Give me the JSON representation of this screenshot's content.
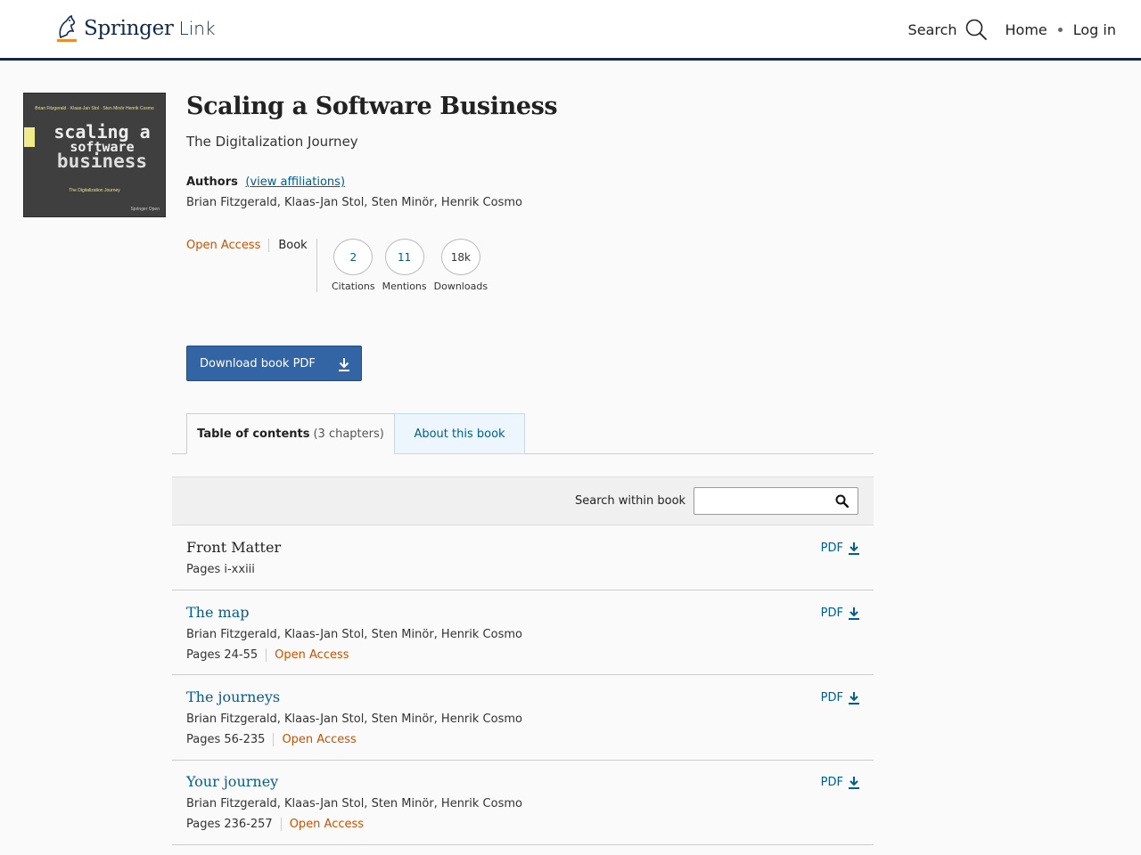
{
  "header": {
    "logo_word": "Springer",
    "logo_sub": "Link",
    "nav": {
      "search": "Search",
      "home": "Home",
      "login": "Log in"
    }
  },
  "cover": {
    "authors": "Brian Fitzgerald · Klaas-Jan Stol · Sten Minör Henrik Cosmo",
    "title_1": "scaling a",
    "title_2": "software",
    "title_3": "business",
    "subtitle": "The Digitalization Journey",
    "publisher": "Springer Open"
  },
  "book": {
    "title": "Scaling a Software Business",
    "subtitle": "The Digitalization Journey",
    "authors_label": "Authors",
    "affiliations_link": "(view affiliations)",
    "authors": "Brian Fitzgerald, Klaas-Jan Stol, Sten Minör, Henrik Cosmo",
    "access": "Open Access",
    "type": "Book"
  },
  "metrics": [
    {
      "value": "2",
      "label": "Citations"
    },
    {
      "value": "11",
      "label": "Mentions"
    },
    {
      "value": "18k",
      "label": "Downloads"
    }
  ],
  "download_button": "Download book PDF",
  "tabs": {
    "toc_label": "Table of contents",
    "toc_count": "(3 chapters)",
    "about_label": "About this book"
  },
  "search_within": {
    "label": "Search within book",
    "value": ""
  },
  "chapters": [
    {
      "title": "Front Matter",
      "authors": "",
      "pages": "Pages i-xxiii",
      "access": "",
      "pdf": "PDF"
    },
    {
      "title": "The map",
      "authors": "Brian Fitzgerald, Klaas-Jan Stol, Sten Minör, Henrik Cosmo",
      "pages": "Pages 24-55",
      "access": "Open Access",
      "pdf": "PDF"
    },
    {
      "title": "The journeys",
      "authors": "Brian Fitzgerald, Klaas-Jan Stol, Sten Minör, Henrik Cosmo",
      "pages": "Pages 56-235",
      "access": "Open Access",
      "pdf": "PDF"
    },
    {
      "title": "Your journey",
      "authors": "Brian Fitzgerald, Klaas-Jan Stol, Sten Minör, Henrik Cosmo",
      "pages": "Pages 236-257",
      "access": "Open Access",
      "pdf": "PDF"
    }
  ],
  "colors": {
    "brand_navy": "#0e2a4f",
    "link_blue": "#025e8d",
    "open_access_orange": "#c65301",
    "button_blue": "#3365a4"
  }
}
